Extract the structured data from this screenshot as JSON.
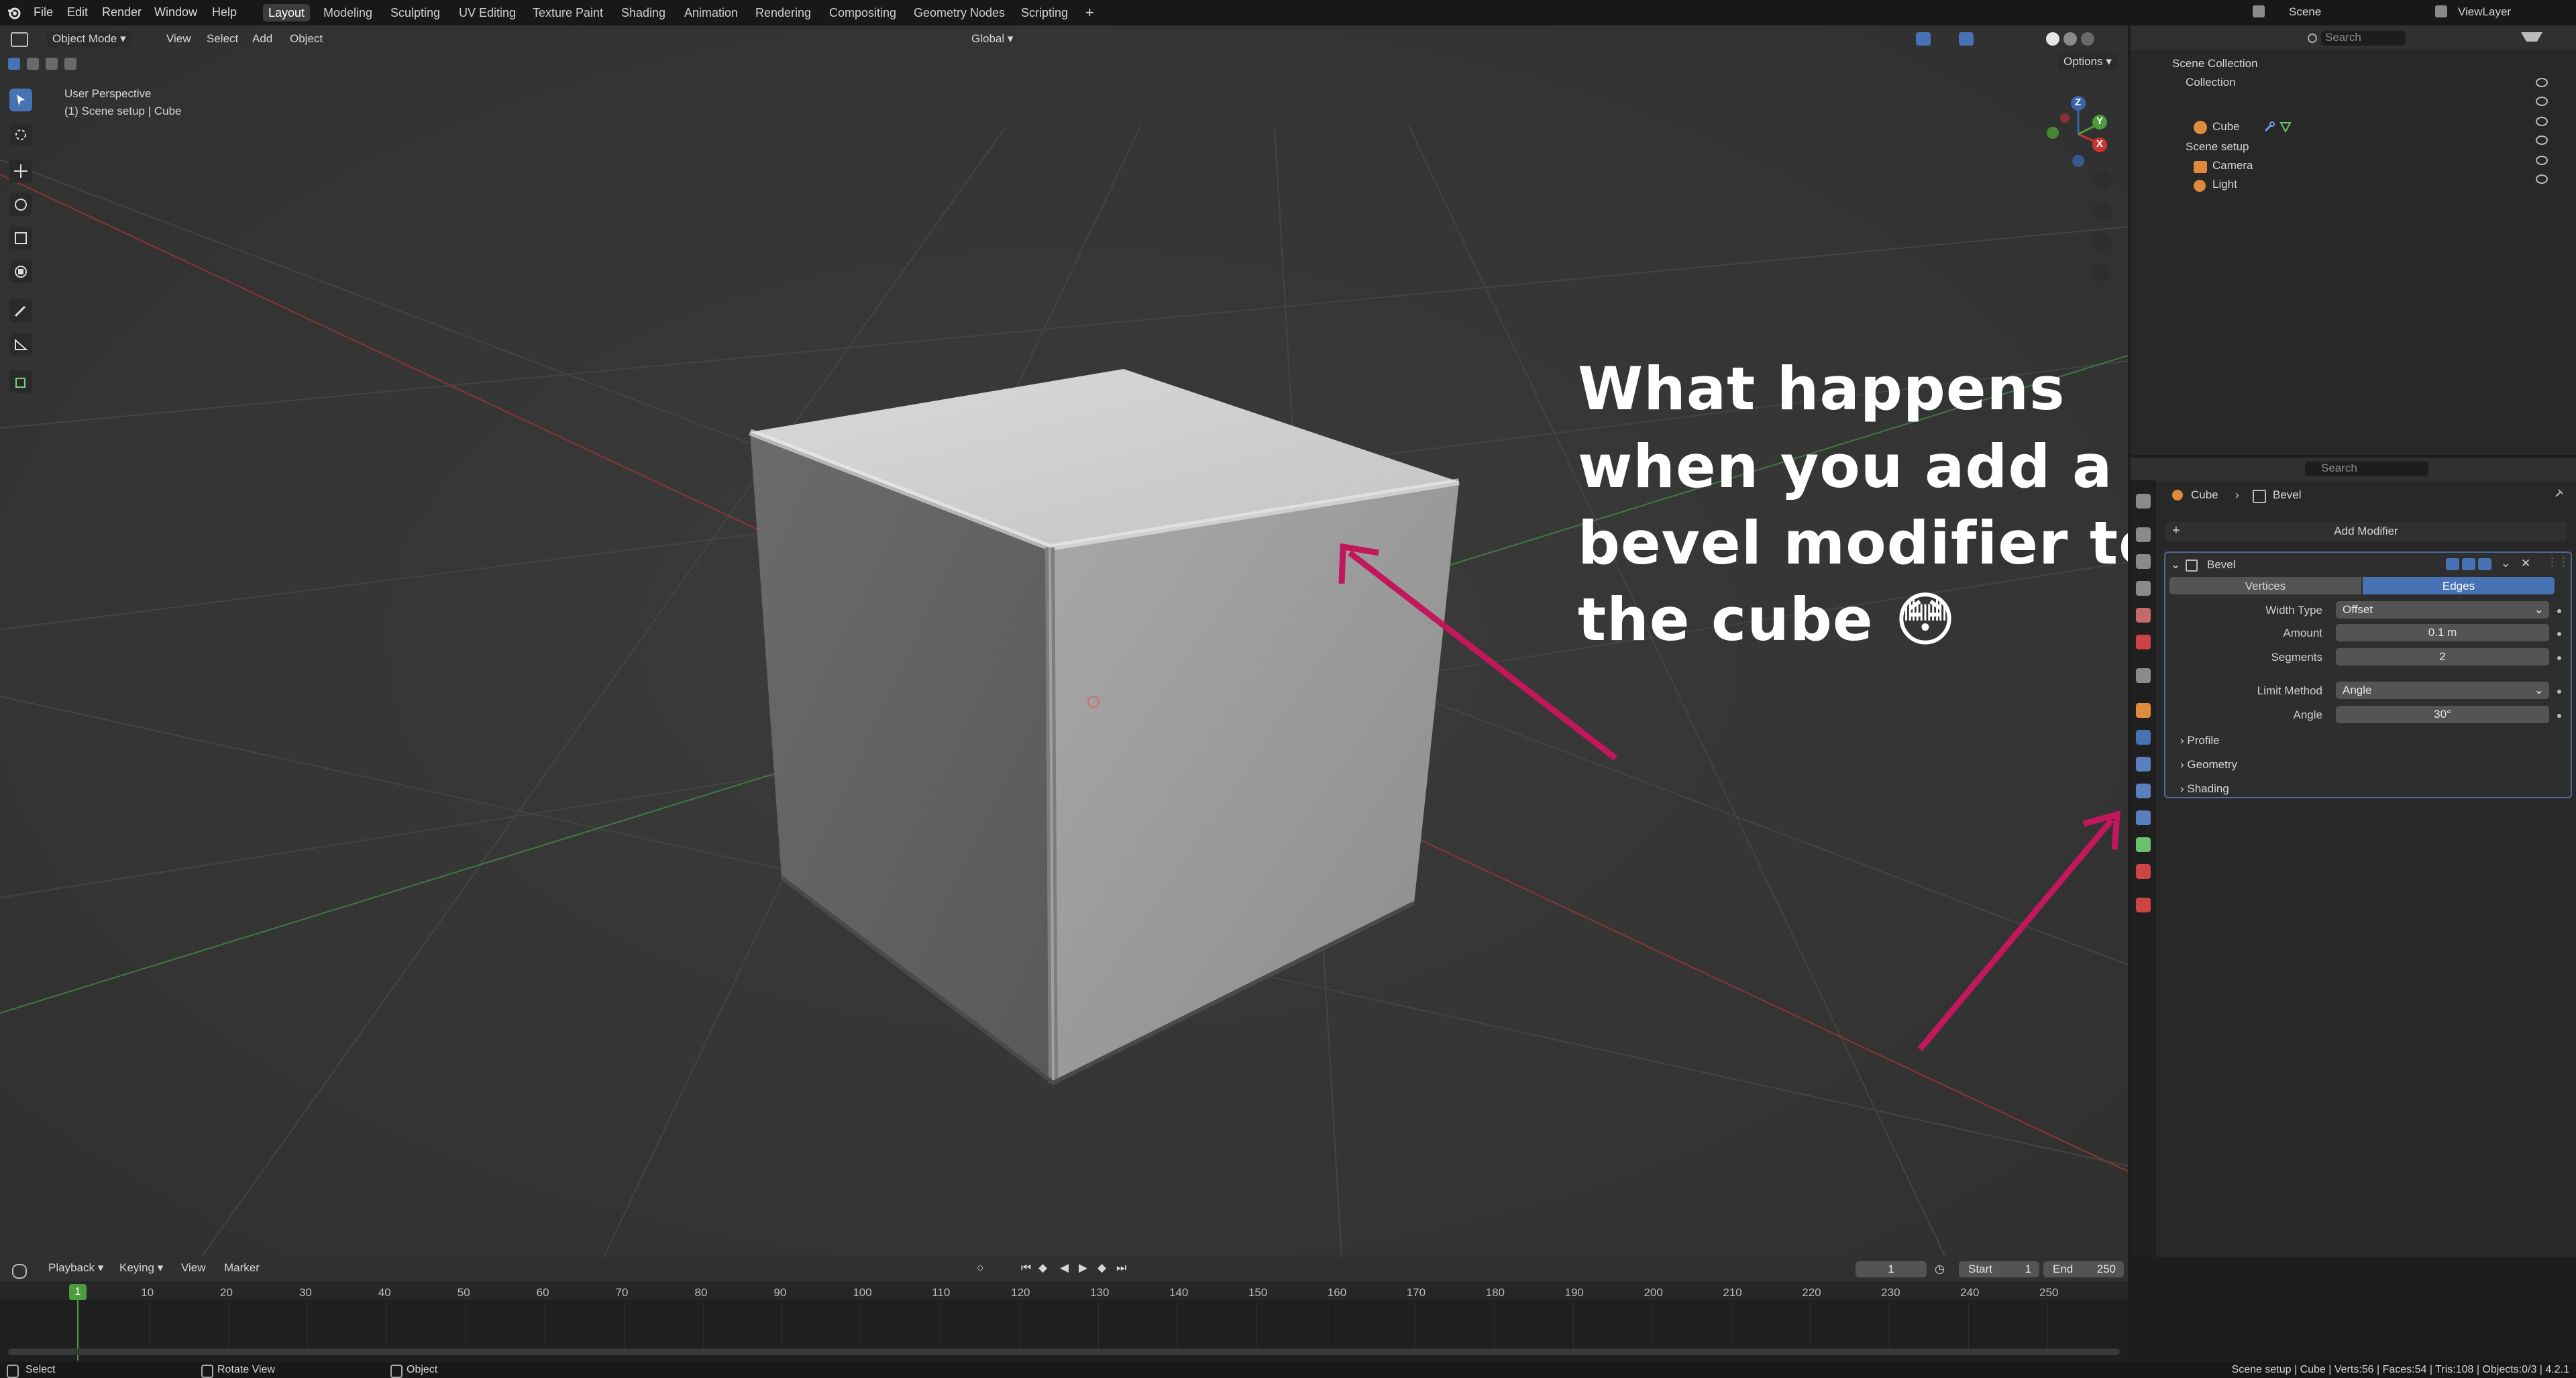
{
  "menu": {
    "file": "File",
    "edit": "Edit",
    "render": "Render",
    "window": "Window",
    "help": "Help"
  },
  "workspaces": [
    "Layout",
    "Modeling",
    "Sculpting",
    "UV Editing",
    "Texture Paint",
    "Shading",
    "Animation",
    "Rendering",
    "Compositing",
    "Geometry Nodes",
    "Scripting"
  ],
  "topbar_right": {
    "scene": "Scene",
    "view_layer": "ViewLayer"
  },
  "viewport": {
    "mode": "Object Mode",
    "view": "View",
    "select": "Select",
    "add": "Add",
    "object": "Object",
    "orientation": "Global",
    "options": "Options",
    "perspective": "User Perspective",
    "collection_info": "(1) Scene setup | Cube",
    "gizmo_axes": {
      "x": "X",
      "y": "Y",
      "z": "Z"
    }
  },
  "annotation": {
    "line1": "What happens",
    "line2": "when you add a",
    "line3": "bevel modifier to",
    "line4": "the cube 😳",
    "arrow_color": "#c2185b"
  },
  "outliner": {
    "search_placeholder": "Search",
    "root": "Scene Collection",
    "items": [
      {
        "label": "Collection"
      },
      {
        "label": "Cube"
      },
      {
        "label": "Scene setup"
      },
      {
        "label": "Camera"
      },
      {
        "label": "Light"
      }
    ]
  },
  "properties": {
    "search_placeholder": "Search",
    "breadcrumb_object": "Cube",
    "breadcrumb_modifier": "Bevel",
    "add_modifier": "Add Modifier",
    "modifier_name": "Bevel",
    "affect_tabs": [
      "Vertices",
      "Edges"
    ],
    "active_tab": "Edges",
    "fields": [
      {
        "label": "Width Type",
        "value": "Offset"
      },
      {
        "label": "Amount",
        "value": "0.1 m"
      },
      {
        "label": "Segments",
        "value": "2"
      },
      {
        "label": "Limit Method",
        "value": "Angle"
      },
      {
        "label": "Angle",
        "value": "30°"
      }
    ],
    "subpanels": [
      "Profile",
      "Geometry",
      "Shading"
    ]
  },
  "timeline": {
    "playback": "Playback",
    "keying": "Keying",
    "view": "View",
    "marker": "Marker",
    "current_frame": "1",
    "start_label": "Start",
    "start": "1",
    "end_label": "End",
    "end": "250",
    "ticks": [
      "1",
      "10",
      "20",
      "30",
      "40",
      "50",
      "60",
      "70",
      "80",
      "90",
      "100",
      "110",
      "120",
      "130",
      "140",
      "150",
      "160",
      "170",
      "180",
      "190",
      "200",
      "210",
      "220",
      "230",
      "240",
      "250"
    ]
  },
  "statusbar": {
    "select": "Select",
    "rotate": "Rotate View",
    "object": "Object",
    "stats": "Scene setup | Cube | Verts:56 | Faces:54 | Tris:108 | Objects:0/3 | 4.2.1"
  },
  "colors": {
    "accent": "#4772b3",
    "active_frame": "#4c9c3a",
    "arrow": "#c2185b"
  }
}
